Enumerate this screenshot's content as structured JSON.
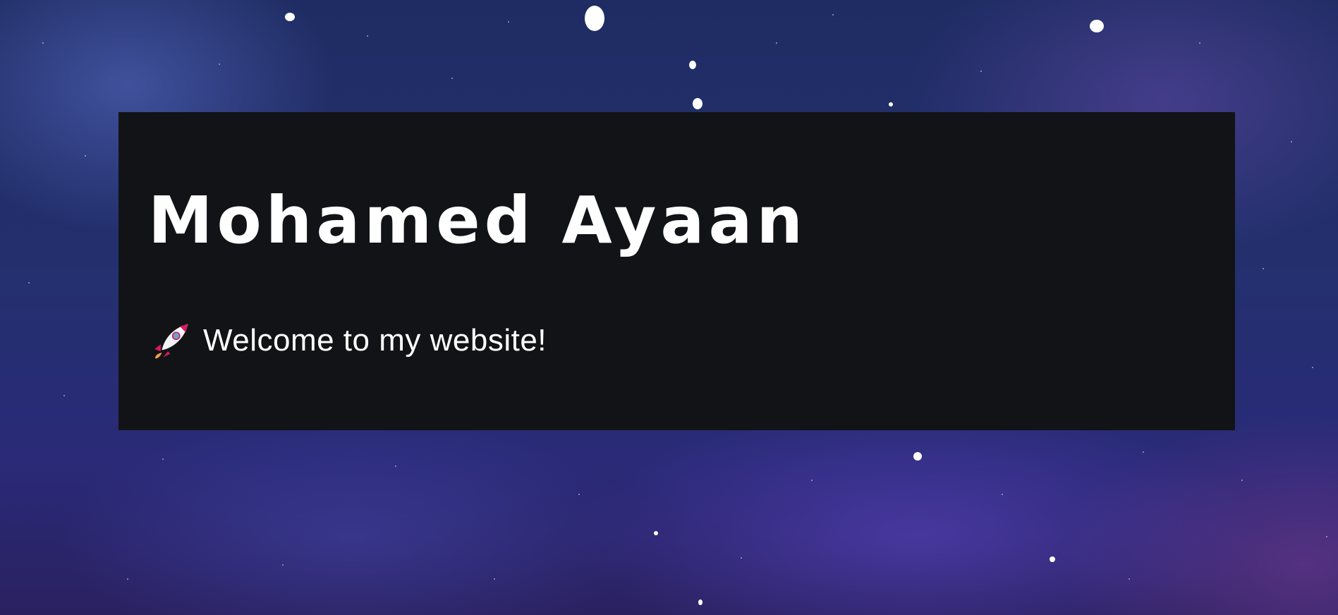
{
  "hero": {
    "title": "Mohamed Ayaan",
    "welcome_icon": "rocket-icon",
    "welcome_text": "Welcome to my website!"
  },
  "colors": {
    "card_background": "#121316",
    "text": "#ffffff",
    "space_background": "#24306f"
  }
}
